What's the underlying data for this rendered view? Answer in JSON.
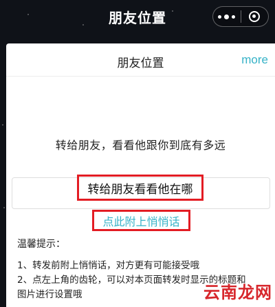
{
  "nav": {
    "title": "朋友位置",
    "menu_icon": "more-dots-icon",
    "close_icon": "ring-close-icon"
  },
  "panel": {
    "title": "朋友位置",
    "more_label": "more",
    "headline": "转给朋友，看看他跟你到底有多远",
    "share_button_label": "转给朋友看看他在哪",
    "note_link_label": "点此附上悄悄话",
    "tips_title": "温馨提示：",
    "tips": [
      "1、转发前附上悄悄话，对方更有可能接受哦",
      "2、点左上角的齿轮，可以对本页面转发时显示的标题和图片进行设置哦"
    ]
  },
  "watermark": {
    "text": "云南龙网"
  },
  "colors": {
    "accent": "#35b2c7",
    "highlight_border": "#e31c23",
    "background": "#0f1218"
  }
}
